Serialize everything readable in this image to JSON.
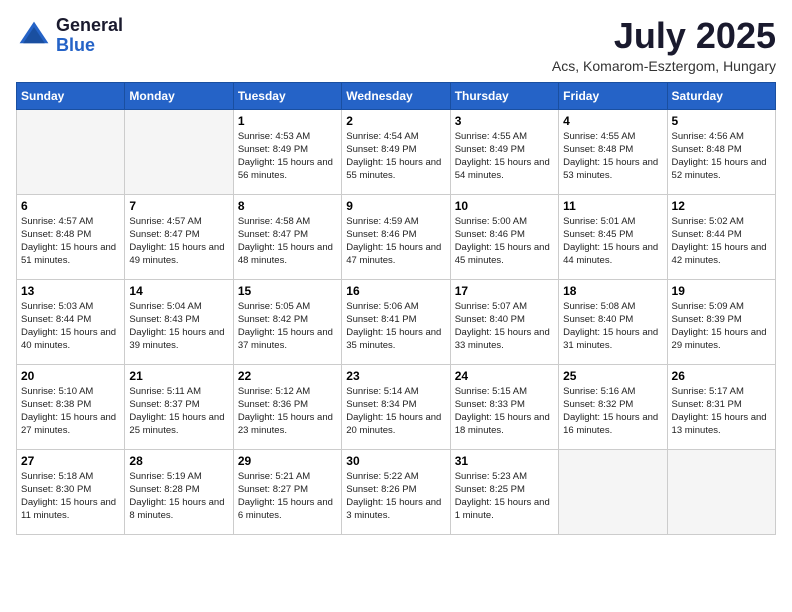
{
  "logo": {
    "general": "General",
    "blue": "Blue"
  },
  "title": "July 2025",
  "subtitle": "Acs, Komarom-Esztergom, Hungary",
  "days_of_week": [
    "Sunday",
    "Monday",
    "Tuesday",
    "Wednesday",
    "Thursday",
    "Friday",
    "Saturday"
  ],
  "weeks": [
    [
      {
        "day": "",
        "info": ""
      },
      {
        "day": "",
        "info": ""
      },
      {
        "day": "1",
        "info": "Sunrise: 4:53 AM\nSunset: 8:49 PM\nDaylight: 15 hours and 56 minutes."
      },
      {
        "day": "2",
        "info": "Sunrise: 4:54 AM\nSunset: 8:49 PM\nDaylight: 15 hours and 55 minutes."
      },
      {
        "day": "3",
        "info": "Sunrise: 4:55 AM\nSunset: 8:49 PM\nDaylight: 15 hours and 54 minutes."
      },
      {
        "day": "4",
        "info": "Sunrise: 4:55 AM\nSunset: 8:48 PM\nDaylight: 15 hours and 53 minutes."
      },
      {
        "day": "5",
        "info": "Sunrise: 4:56 AM\nSunset: 8:48 PM\nDaylight: 15 hours and 52 minutes."
      }
    ],
    [
      {
        "day": "6",
        "info": "Sunrise: 4:57 AM\nSunset: 8:48 PM\nDaylight: 15 hours and 51 minutes."
      },
      {
        "day": "7",
        "info": "Sunrise: 4:57 AM\nSunset: 8:47 PM\nDaylight: 15 hours and 49 minutes."
      },
      {
        "day": "8",
        "info": "Sunrise: 4:58 AM\nSunset: 8:47 PM\nDaylight: 15 hours and 48 minutes."
      },
      {
        "day": "9",
        "info": "Sunrise: 4:59 AM\nSunset: 8:46 PM\nDaylight: 15 hours and 47 minutes."
      },
      {
        "day": "10",
        "info": "Sunrise: 5:00 AM\nSunset: 8:46 PM\nDaylight: 15 hours and 45 minutes."
      },
      {
        "day": "11",
        "info": "Sunrise: 5:01 AM\nSunset: 8:45 PM\nDaylight: 15 hours and 44 minutes."
      },
      {
        "day": "12",
        "info": "Sunrise: 5:02 AM\nSunset: 8:44 PM\nDaylight: 15 hours and 42 minutes."
      }
    ],
    [
      {
        "day": "13",
        "info": "Sunrise: 5:03 AM\nSunset: 8:44 PM\nDaylight: 15 hours and 40 minutes."
      },
      {
        "day": "14",
        "info": "Sunrise: 5:04 AM\nSunset: 8:43 PM\nDaylight: 15 hours and 39 minutes."
      },
      {
        "day": "15",
        "info": "Sunrise: 5:05 AM\nSunset: 8:42 PM\nDaylight: 15 hours and 37 minutes."
      },
      {
        "day": "16",
        "info": "Sunrise: 5:06 AM\nSunset: 8:41 PM\nDaylight: 15 hours and 35 minutes."
      },
      {
        "day": "17",
        "info": "Sunrise: 5:07 AM\nSunset: 8:40 PM\nDaylight: 15 hours and 33 minutes."
      },
      {
        "day": "18",
        "info": "Sunrise: 5:08 AM\nSunset: 8:40 PM\nDaylight: 15 hours and 31 minutes."
      },
      {
        "day": "19",
        "info": "Sunrise: 5:09 AM\nSunset: 8:39 PM\nDaylight: 15 hours and 29 minutes."
      }
    ],
    [
      {
        "day": "20",
        "info": "Sunrise: 5:10 AM\nSunset: 8:38 PM\nDaylight: 15 hours and 27 minutes."
      },
      {
        "day": "21",
        "info": "Sunrise: 5:11 AM\nSunset: 8:37 PM\nDaylight: 15 hours and 25 minutes."
      },
      {
        "day": "22",
        "info": "Sunrise: 5:12 AM\nSunset: 8:36 PM\nDaylight: 15 hours and 23 minutes."
      },
      {
        "day": "23",
        "info": "Sunrise: 5:14 AM\nSunset: 8:34 PM\nDaylight: 15 hours and 20 minutes."
      },
      {
        "day": "24",
        "info": "Sunrise: 5:15 AM\nSunset: 8:33 PM\nDaylight: 15 hours and 18 minutes."
      },
      {
        "day": "25",
        "info": "Sunrise: 5:16 AM\nSunset: 8:32 PM\nDaylight: 15 hours and 16 minutes."
      },
      {
        "day": "26",
        "info": "Sunrise: 5:17 AM\nSunset: 8:31 PM\nDaylight: 15 hours and 13 minutes."
      }
    ],
    [
      {
        "day": "27",
        "info": "Sunrise: 5:18 AM\nSunset: 8:30 PM\nDaylight: 15 hours and 11 minutes."
      },
      {
        "day": "28",
        "info": "Sunrise: 5:19 AM\nSunset: 8:28 PM\nDaylight: 15 hours and 8 minutes."
      },
      {
        "day": "29",
        "info": "Sunrise: 5:21 AM\nSunset: 8:27 PM\nDaylight: 15 hours and 6 minutes."
      },
      {
        "day": "30",
        "info": "Sunrise: 5:22 AM\nSunset: 8:26 PM\nDaylight: 15 hours and 3 minutes."
      },
      {
        "day": "31",
        "info": "Sunrise: 5:23 AM\nSunset: 8:25 PM\nDaylight: 15 hours and 1 minute."
      },
      {
        "day": "",
        "info": ""
      },
      {
        "day": "",
        "info": ""
      }
    ]
  ]
}
